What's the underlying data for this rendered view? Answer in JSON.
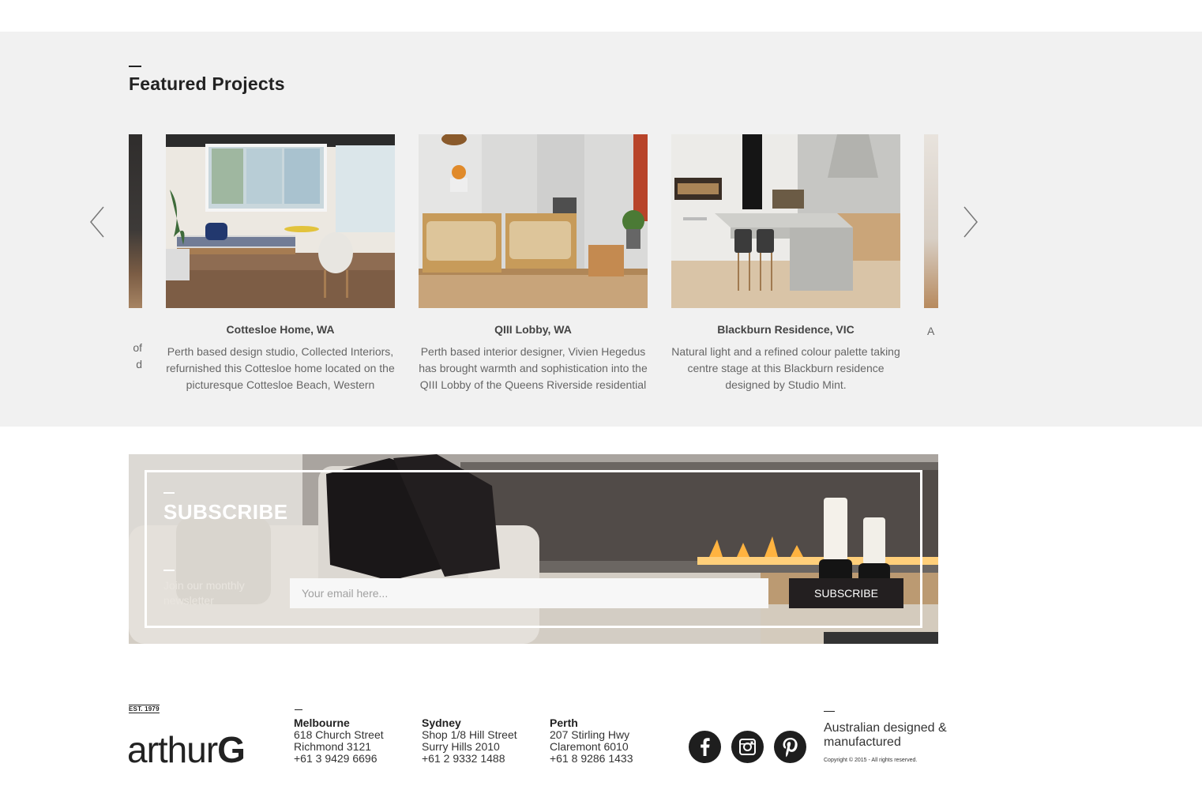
{
  "featured": {
    "title": "Featured Projects",
    "cards": [
      {
        "title": "",
        "desc_line1": "of",
        "desc_line2": "d",
        "image": "interior-photo-partial"
      },
      {
        "title": "Cottesloe Home, WA",
        "desc": "Perth based design studio, Collected Interiors, refurnished this Cottesloe home located on the picturesque Cottesloe Beach, Western",
        "image": "sunroom-photo"
      },
      {
        "title": "QIII Lobby, WA",
        "desc": "Perth based interior designer, Vivien Hegedus has brought warmth and sophistication into the QIII Lobby of the Queens Riverside residential",
        "image": "lobby-armchairs-photo"
      },
      {
        "title": "Blackburn Residence, VIC",
        "desc": "Natural light and a refined colour palette taking centre stage at this Blackburn residence designed by Studio Mint.",
        "image": "kitchen-photo"
      },
      {
        "title": "",
        "desc": "A",
        "image": "interior-photo-partial"
      }
    ]
  },
  "subscribe": {
    "title": "SUBSCRIBE",
    "tagline": "Join our monthly newsletter",
    "email_placeholder": "Your email here...",
    "button_label": "SUBSCRIBE"
  },
  "footer": {
    "est": "EST. 1979",
    "logo_light": "arthur",
    "logo_bold": "G",
    "offices": [
      {
        "city": "Melbourne",
        "line1": "618 Church Street",
        "line2": "Richmond 3121",
        "phone": "+61 3 9429 6696"
      },
      {
        "city": "Sydney",
        "line1": "Shop 1/8 Hill Street",
        "line2": "Surry Hills 2010",
        "phone": "+61 2 9332 1488"
      },
      {
        "city": "Perth",
        "line1": "207 Stirling Hwy",
        "line2": "Claremont 6010",
        "phone": "+61 8 9286 1433"
      }
    ],
    "social": [
      "facebook-icon",
      "instagram-icon",
      "pinterest-icon"
    ],
    "tagline": "Australian designed & manufactured",
    "copyright": "Copyright © 2015 - All rights reserved."
  }
}
